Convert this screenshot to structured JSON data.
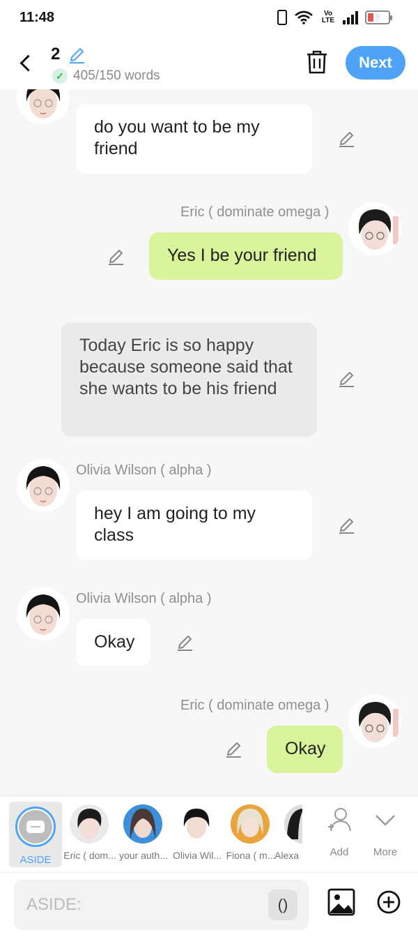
{
  "status_bar": {
    "time": "11:48",
    "battery": "7",
    "network": "Vo LTE"
  },
  "header": {
    "title": "2",
    "word_count": "405/150 words",
    "next_label": "Next"
  },
  "messages": [
    {
      "side": "left",
      "sender": "",
      "text": "do you want to be my friend"
    },
    {
      "side": "right",
      "sender": "Eric ( dominate omega )",
      "text": "Yes I be your friend"
    },
    {
      "side": "aside",
      "sender": "",
      "text": "Today Eric is so happy because someone said that she wants to be his friend"
    },
    {
      "side": "left",
      "sender": "Olivia Wilson ( alpha )",
      "text": "hey I am going to my class"
    },
    {
      "side": "left",
      "sender": "Olivia Wilson ( alpha )",
      "text": "Okay"
    },
    {
      "side": "right",
      "sender": "Eric ( dominate omega )",
      "text": "Okay"
    }
  ],
  "character_bar": {
    "aside_label": "ASIDE",
    "characters": [
      {
        "label": "Eric ( dom...",
        "icon": "eric-avatar-icon"
      },
      {
        "label": "your auth...",
        "icon": "author-avatar-icon"
      },
      {
        "label": "Olivia Wil...",
        "icon": "olivia-avatar-icon"
      },
      {
        "label": "Fiona ( m...",
        "icon": "fiona-avatar-icon"
      },
      {
        "label": "Alexa",
        "icon": "alexa-avatar-icon"
      }
    ],
    "add_label": "Add",
    "more_label": "More"
  },
  "input": {
    "placeholder": "ASIDE:",
    "paren_label": "()"
  },
  "colors": {
    "accent": "#4ea3f6",
    "right_bubble": "#d8f39a",
    "aside_bubble": "#ebebeb"
  }
}
